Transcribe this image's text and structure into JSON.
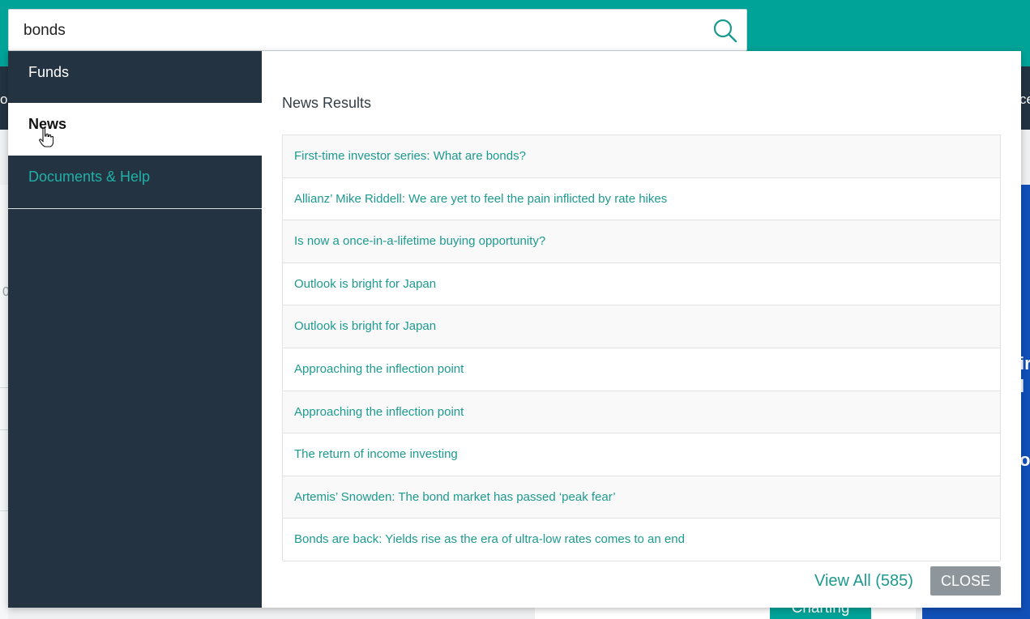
{
  "background": {
    "nav_left_text": "o",
    "nav_right_text": "ce",
    "left_zero": "0",
    "blue_panel_lines": [
      "ir",
      "l",
      "",
      "or"
    ],
    "charting_button": "Charting"
  },
  "search": {
    "value": "bonds",
    "icon": "search-icon"
  },
  "sidebar": {
    "items": [
      {
        "label": "Funds",
        "state": "default"
      },
      {
        "label": "News",
        "state": "active"
      },
      {
        "label": "Documents & Help",
        "state": "link"
      }
    ]
  },
  "results": {
    "heading": "News Results",
    "items": [
      "First-time investor series: What are bonds?",
      "Allianz’ Mike Riddell: We are yet to feel the pain inflicted by rate hikes",
      "Is now a once-in-a-lifetime buying opportunity?",
      "Outlook is bright for Japan",
      "Outlook is bright for Japan",
      "Approaching the inflection point",
      "Approaching the inflection point",
      "The return of income investing",
      "Artemis’ Snowden: The bond market has passed ‘peak fear’",
      "Bonds are back: Yields rise as the era of ultra-low rates comes to an end"
    ],
    "view_all": "View All (585)",
    "close": "CLOSE"
  },
  "colors": {
    "teal": "#00a398",
    "navy": "#243342",
    "link": "#1d9a8f",
    "blue_panel": "#1150b7",
    "close_button": "#8e969c"
  }
}
